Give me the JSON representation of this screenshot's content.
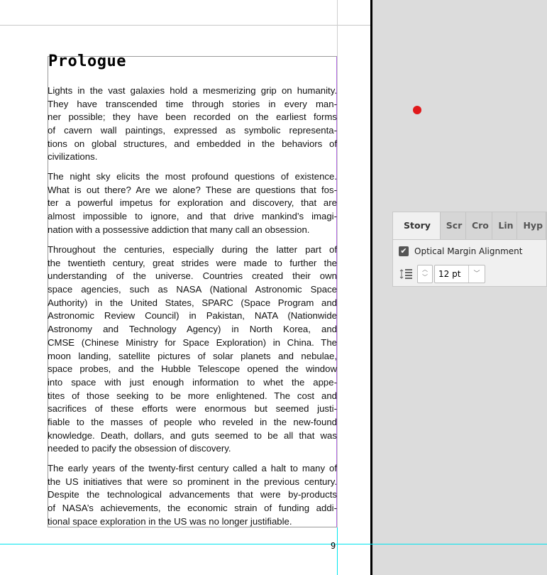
{
  "document": {
    "title": "Prologue",
    "page_number": "9",
    "paragraphs": [
      [
        "Lights in the vast galaxies hold a mesmerizing grip on humanity.",
        "They have transcended time through stories in every man-",
        "ner possible; they have been recorded on the earliest forms",
        "of cavern wall paintings, expressed as symbolic representa-",
        "tions on global structures, and embedded in the behaviors of",
        "civilizations."
      ],
      [
        "The night sky elicits the most profound questions of existence.",
        "What is out there? Are we alone? These are questions that fos-",
        "ter a powerful impetus for exploration and discovery, that are",
        "almost impossible to ignore, and that drive mankind’s imagi-",
        "nation with a possessive addiction that many call an obsession."
      ],
      [
        "Throughout the centuries, especially during the latter part of",
        "the twentieth century, great strides were made to further the",
        "understanding of the universe. Countries created their own",
        "space agencies, such as NASA (National Astronomic Space",
        "Authority) in the United States, SPARC (Space Program and",
        "Astronomic Review Council) in Pakistan, NATA (Nationwide",
        "Astronomy and Technology Agency) in North Korea, and",
        "CMSE (Chinese Ministry for Space Exploration) in China. The",
        "moon landing, satellite pictures of solar planets and nebulae,",
        "space probes, and the Hubble Telescope opened the window",
        "into space with just enough information to whet the appe-",
        "tites of those seeking to be more enlightened. The cost and",
        "sacrifices of these efforts were enormous but seemed justi-",
        "fiable to the masses of people who reveled in the new-found",
        "knowledge. Death, dollars, and guts seemed to be all that was",
        "needed to pacify the obsession of discovery."
      ],
      [
        "The early years of the twenty-first century called a halt to many of",
        "the US initiatives that were so prominent in the previous century.",
        "Despite the technological advancements that were by-products",
        "of NASA’s achievements, the economic strain of funding addi-",
        "tional space exploration in the US was no longer justifiable."
      ]
    ]
  },
  "panel": {
    "tabs": [
      "Story",
      "Scr",
      "Cro",
      "Lin",
      "Hyp"
    ],
    "optical_margin_label": "Optical Margin Alignment",
    "optical_margin_checked": true,
    "checkmark": "✔",
    "size_value": "12 pt",
    "up": "︿",
    "down": "﹀",
    "dropdown": "﹀"
  },
  "colors": {
    "guide_cyan": "#00e5ee",
    "marker_red": "#e0191b"
  }
}
